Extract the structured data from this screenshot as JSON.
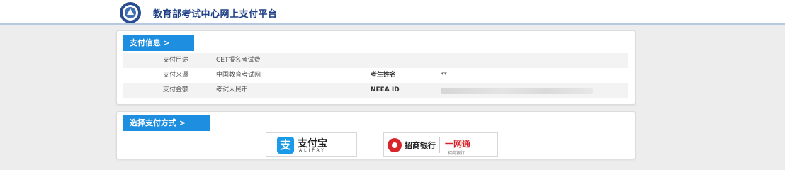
{
  "header": {
    "site_title": "教育部考试中心网上支付平台"
  },
  "payment_info": {
    "section_title": "支付信息 >",
    "rows": [
      {
        "label": "支付用途",
        "value": "CET报名考试费"
      },
      {
        "label": "支付来源",
        "value": "中国教育考试网",
        "label2": "考生姓名",
        "value2": "**"
      },
      {
        "label": "支付金额",
        "value": "考试人民币",
        "label2": "NEEA ID",
        "value2": ""
      }
    ]
  },
  "payment_method": {
    "section_title": "选择支付方式 >",
    "options": [
      {
        "name": "支付宝",
        "sub": "ALIPAY",
        "icon": "alipay-icon",
        "color": "#1a9be8"
      },
      {
        "name": "招商银行",
        "product": "一网通",
        "sub": "招商银行",
        "icon": "cmb-icon",
        "color": "#d9242b"
      }
    ]
  }
}
